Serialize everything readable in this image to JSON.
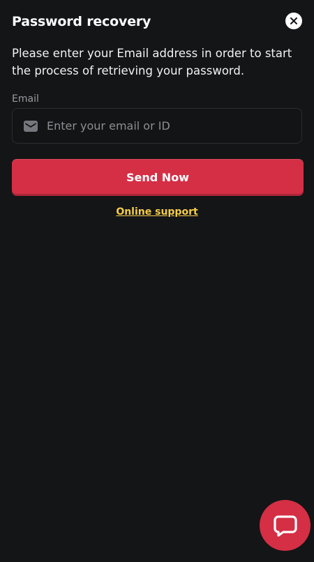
{
  "modal": {
    "title": "Password recovery",
    "close_icon": "close-icon",
    "description": "Please enter your Email address in order to start the process of retrieving your password.",
    "email_label": "Email",
    "email_placeholder": "Enter your email or ID",
    "email_value": "",
    "email_icon": "envelope-icon",
    "send_button_label": "Send Now",
    "support_link_label": "Online support"
  },
  "chat_widget": {
    "icon": "chat-bubble-icon"
  },
  "colors": {
    "background": "#141517",
    "accent": "#d42f45",
    "link": "#f4cd4a",
    "muted_text": "#9a9ba1"
  }
}
